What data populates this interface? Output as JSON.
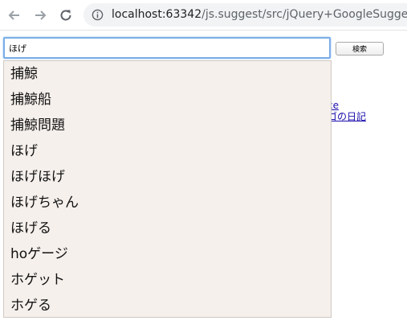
{
  "browser": {
    "url_host": "localhost:63342",
    "url_path": "/js.suggest/src/jQuery+GoogleSuggest+c"
  },
  "search": {
    "value": "ほげ",
    "button_label": "検索"
  },
  "background_links": [
    "ce",
    "ゴの日記"
  ],
  "suggestions": [
    "捕鯨",
    "捕鯨船",
    "捕鯨問題",
    "ほげ",
    "ほげほげ",
    "ほげちゃん",
    "ほげる",
    "hoゲージ",
    "ホゲット",
    "ホゲる"
  ],
  "colors": {
    "suggest_background": "#f5f0ec",
    "input_focus_border": "#7baee8",
    "link": "#1a0dab"
  },
  "icons": {
    "back": "back-arrow-icon",
    "forward": "forward-arrow-icon",
    "reload": "reload-icon",
    "info": "info-icon"
  }
}
